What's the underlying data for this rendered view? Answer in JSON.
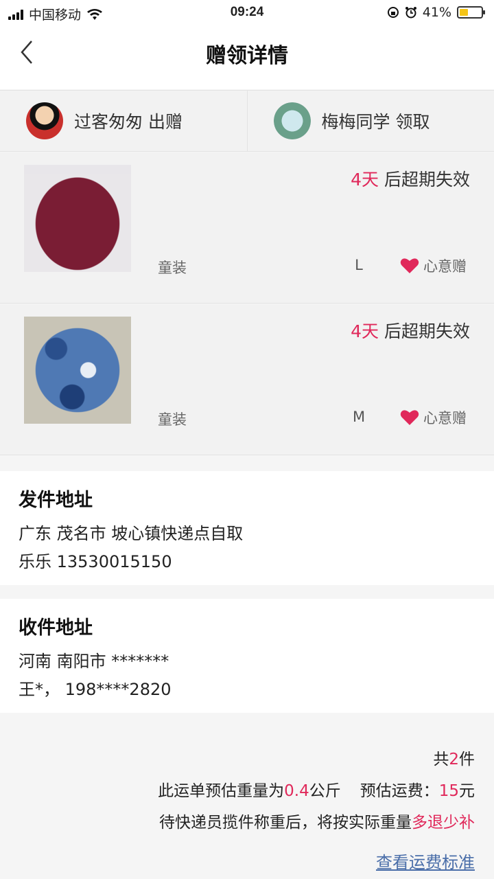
{
  "status_bar": {
    "carrier": "中国移动",
    "time": "09:24",
    "battery": "41%",
    "battery_level": 0.41
  },
  "nav": {
    "title": "赠领详情",
    "back_icon": "chevron-left-icon"
  },
  "users": {
    "giver": "过客匆匆 出赠",
    "receiver": "梅梅同学 领取"
  },
  "items": [
    {
      "expire_days": "4天",
      "expire_text": " 后超期失效",
      "category": "童装",
      "size": "L",
      "gift_type": "心意赠"
    },
    {
      "expire_days": "4天",
      "expire_text": " 后超期失效",
      "category": "童装",
      "size": "M",
      "gift_type": "心意赠"
    }
  ],
  "sender_address": {
    "title": "发件地址",
    "line1": "广东 茂名市 坡心镇快递点自取",
    "line2": "乐乐 13530015150"
  },
  "receiver_address": {
    "title": "收件地址",
    "line1": "河南 南阳市 *******",
    "line2": "王*， 198****2820"
  },
  "summary": {
    "count_prefix": "共",
    "count": "2",
    "count_suffix": "件",
    "weight_prefix": "此运单预估重量为",
    "weight": "0.4",
    "weight_unit": "公斤",
    "fee_label": "预估运费：",
    "fee": "15",
    "fee_unit": "元",
    "note_prefix": "待快递员揽件称重后，将按实际重量",
    "note_accent": "多退少补",
    "link": "查看运费标准"
  },
  "colors": {
    "accent": "#e0285a",
    "link": "#4a6ea9"
  }
}
